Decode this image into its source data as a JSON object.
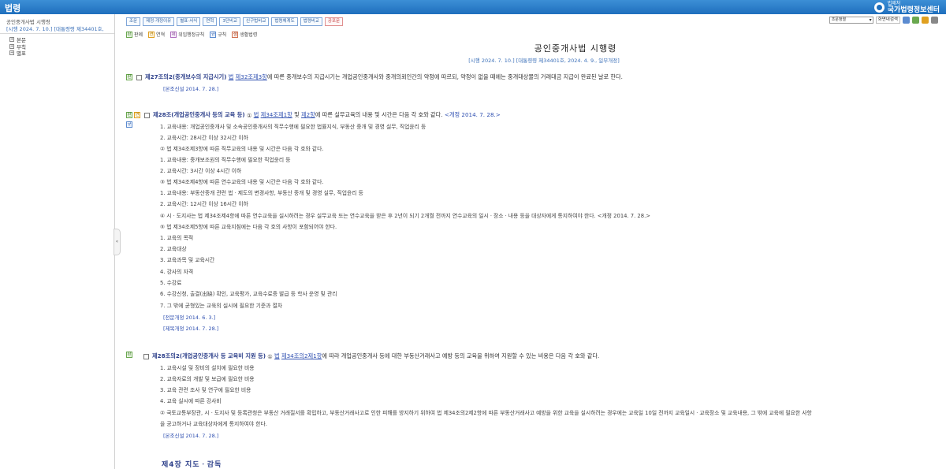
{
  "topbar": {
    "title": "법령",
    "logo_small": "법제처",
    "logo_big": "국가법령정보센터"
  },
  "sidebar": {
    "law_name": "공인중개사법 시행령",
    "law_date": "[시행 2024. 7. 10.] [대통령령 제34401호,",
    "tree": [
      {
        "label": "본문"
      },
      {
        "label": "부칙"
      },
      {
        "label": "별표"
      }
    ],
    "collapse_glyph": "«"
  },
  "toolbar": {
    "buttons": [
      "조문",
      "제정·개정이유",
      "별표·서식",
      "연혁",
      "3단비교",
      "신구법비교",
      "법령체계도",
      "법령비교",
      "공포문"
    ],
    "red_button": "공포문"
  },
  "right_controls": {
    "select_value": "조문정렬",
    "print_label": "화면내검색"
  },
  "legend": [
    {
      "icon": "판",
      "label": "판례"
    },
    {
      "icon": "연",
      "label": "연혁"
    },
    {
      "icon": "위",
      "label": "위임행정규칙"
    },
    {
      "icon": "규",
      "label": "규칙"
    },
    {
      "icon": "생",
      "label": "생활법령"
    }
  ],
  "doc": {
    "title": "공인중개사법 시행령",
    "subtitle": "[시행 2024. 7. 10.] [대통령령 제34401호, 2024. 4. 9., 일부개정]"
  },
  "art27": {
    "title": "제27조의2(중개보수의 지급시기)",
    "link1": "법",
    "link2": "제32조제3항",
    "text": "에 따른 중개보수의 지급시기는 개업공인중개사와 중개의뢰인간의 약정에 따르되, 약정이 없을 때에는 중개대상물의 거래대금 지급이 완료된 날로 한다.",
    "note": "[본조신설 2014. 7. 28.]"
  },
  "art28": {
    "title": "제28조(개업공인중개사 등의 교육 등)",
    "para1_prefix": "①",
    "para1_link1": "법",
    "para1_link2": "제34조제1항",
    "para1_mid": "및",
    "para1_link3": "제2항",
    "para1_text": "에 따른 실무교육의 내용 및 시간은 다음 각 호와 같다.",
    "para1_rev": "<개정 2014. 7. 28.>",
    "lines": [
      "1. 교육내용: 개업공인중개사 및 소속공인중개사의 직무수행에 필요한 법률지식, 부동산 중개 및 경영 실무, 직업윤리 등",
      "2. 교육시간: 28시간 이상 32시간 이하",
      "② 법 제34조제3항에 따른 직무교육의 내용 및 시간은 다음 각 호와 같다.",
      "1. 교육내용: 중개보조원의 직무수행에 필요한 직업윤리 등",
      "2. 교육시간: 3시간 이상 4시간 이하",
      "③ 법 제34조제4항에 따른 연수교육의 내용 및 시간은 다음 각 호와 같다.",
      "1. 교육내용: 부동산중개 관련 법ㆍ제도의 변경사항, 부동산 중개 및 경영 실무, 직업윤리 등",
      "2. 교육시간: 12시간 이상 16시간 이하",
      "④ 시ㆍ도지사는 법 제34조제4항에 따른 연수교육을 실시하려는 경우 실무교육 또는 연수교육을 받은 후 2년이 되기 2개월 전까지 연수교육의 일시ㆍ장소ㆍ내용 등을 대상자에게 통지하여야 한다. <개정 2014. 7. 28.>",
      "⑤ 법 제34조제5항에 따른 교육지침에는 다음 각 호의 사항이 포함되어야 한다.",
      "1. 교육의 목적",
      "2. 교육대상",
      "3. 교육과목 및 교육시간",
      "4. 강사의 자격",
      "5. 수강료",
      "6. 수강신청, 출결(出缺) 확인, 교육평가, 교육수료증 발급 등 학사 운영 및 관리",
      "7. 그 밖에 균형있는 교육의 실시에 필요한 기준과 절차"
    ],
    "note1": "[전문개정 2014. 6. 3.]",
    "note2": "[제목개정 2014. 7. 28.]"
  },
  "art28_2": {
    "title": "제28조의2(개업공인중개사 등 교육비 지원 등)",
    "prefix": "①",
    "link1": "법",
    "link2": "제34조의2제1항",
    "text": "에 따라 개업공인중개사 등에 대한 부동산거래사고 예방 등의 교육을 위하여 지원할 수 있는 비용은 다음 각 호와 같다.",
    "lines": [
      "1. 교육시설 및 장비의 설치에 필요한 비용",
      "2. 교육자료의 개발 및 보급에 필요한 비용",
      "3. 교육 관련 조사 및 연구에 필요한 비용",
      "4. 교육 실시에 따른 강사비",
      "② 국토교통부장관, 시ㆍ도지사 및 등록관청은 부동산 거래질서를 확립하고, 부동산거래사고로 인한 피해를 방지하기 위하여 법 제34조의2제2항에 따른 부동산거래사고 예방을 위한 교육을 실시하려는 경우에는 교육일 10일 전까지 교육일시ㆍ교육장소 및 교육내용, 그 밖에 교육에 필요한 사항",
      "을 공고하거나 교육대상자에게 통지하여야 한다."
    ],
    "note": "[본조신설 2014. 7. 28.]"
  },
  "chapter": "제4장 지도ㆍ감독"
}
